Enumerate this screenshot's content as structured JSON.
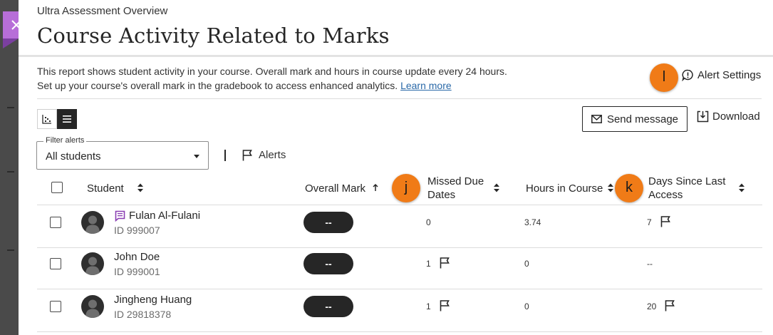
{
  "header": {
    "subtitle": "Ultra Assessment Overview",
    "title": "Course Activity Related to Marks"
  },
  "description": {
    "line1": "This report shows student activity in your course. Overall mark and hours in course update every 24 hours.",
    "line2": "Set up your course's overall mark in the gradebook to access enhanced analytics.",
    "link": "Learn more"
  },
  "callouts": {
    "l": "l",
    "j": "j",
    "k": "k"
  },
  "toolbar": {
    "alert_settings": "Alert Settings",
    "send_message": "Send message",
    "download": "Download"
  },
  "filter": {
    "legend": "Filter alerts",
    "value": "All students",
    "alerts_label": "Alerts"
  },
  "table": {
    "headers": {
      "student": "Student",
      "overall_mark": "Overall Mark",
      "missed_due_dates_1": "Missed Due",
      "missed_due_dates_2": "Dates",
      "hours_in_course": "Hours in Course",
      "days_since_1": "Days Since Last",
      "days_since_2": "Access"
    },
    "rows": [
      {
        "name": "Fulan Al-Fulani",
        "id": "ID 999007",
        "mark": "--",
        "missed": "0",
        "hours": "3.74",
        "days": "7"
      },
      {
        "name": "John Doe",
        "id": "ID 999001",
        "mark": "--",
        "missed": "1",
        "hours": "0",
        "days": "--"
      },
      {
        "name": "Jingheng Huang",
        "id": "ID 29818378",
        "mark": "--",
        "missed": "1",
        "hours": "0",
        "days": "20"
      }
    ]
  },
  "colors": {
    "close_button": "#b76ed8",
    "callout": "#f07b17",
    "link": "#2a69a8",
    "note_icon": "#8a3fb3"
  }
}
